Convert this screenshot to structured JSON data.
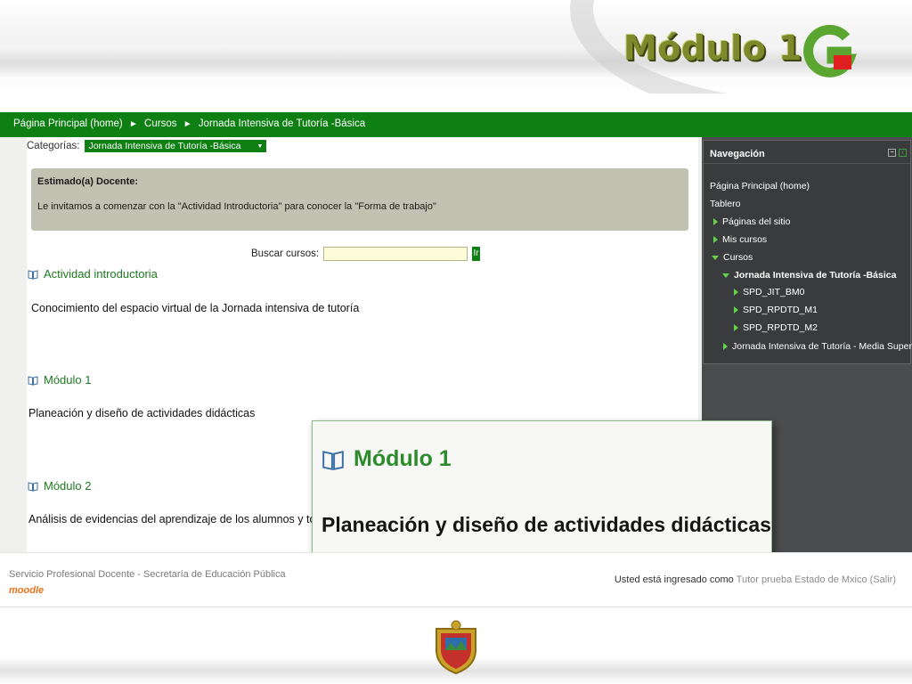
{
  "slide": {
    "title": "Módulo 1"
  },
  "breadcrumb": {
    "items": [
      "Página Principal (home)",
      "Cursos",
      "Jornada Intensiva de Tutoría -Básica"
    ],
    "separator": "►"
  },
  "categories": {
    "label": "Categorías:",
    "selected": "Jornada Intensiva de Tutoría -Básica",
    "arrow": "▼"
  },
  "notice": {
    "title": "Estimado(a) Docente:",
    "text": "Le invitamos a comenzar con la \"Actividad Introductoria\" para conocer la \"Forma de trabajo\""
  },
  "search": {
    "label": "Buscar cursos:",
    "value": "",
    "go_label": "Ir"
  },
  "sections": [
    {
      "title": "Actividad introductoria",
      "description": "Conocimiento del espacio virtual de la Jornada intensiva de tutoría"
    },
    {
      "title": "Módulo 1",
      "description": "Planeación y diseño de actividades didácticas"
    },
    {
      "title": "Módulo 2",
      "description": "Análisis de evidencias del aprendizaje de los alumnos y toma de d"
    }
  ],
  "navigation": {
    "title": "Navegación",
    "items": [
      {
        "label": "Página Principal (home)"
      },
      {
        "label": "Tablero"
      },
      {
        "label": "Páginas del sitio"
      },
      {
        "label": "Mis cursos"
      },
      {
        "label": "Cursos"
      },
      {
        "label": "Jornada Intensiva de Tutoría -Básica"
      },
      {
        "label": "SPD_JIT_BM0"
      },
      {
        "label": "SPD_RPDTD_M1"
      },
      {
        "label": "SPD_RPDTD_M2"
      },
      {
        "label": "Jornada Intensiva de Tutoría - Media Superior"
      }
    ]
  },
  "callout": {
    "title": "Módulo 1",
    "description": "Planeación y diseño de actividades didácticas"
  },
  "footer": {
    "org": "Servicio Profesional Docente - Secretaría de Educación Pública",
    "moodle": "moodle",
    "logged_prefix": "Usted está ingresado como",
    "user": "Tutor prueba Estado de Mxico",
    "logout": "(Salir)"
  },
  "colors": {
    "accent_green": "#0e7f12",
    "link_green": "#1d7a1f",
    "nav_bg": "#3a3b3c",
    "notice_bg": "#c1c2b2",
    "input_bg": "#fdfbd8"
  }
}
